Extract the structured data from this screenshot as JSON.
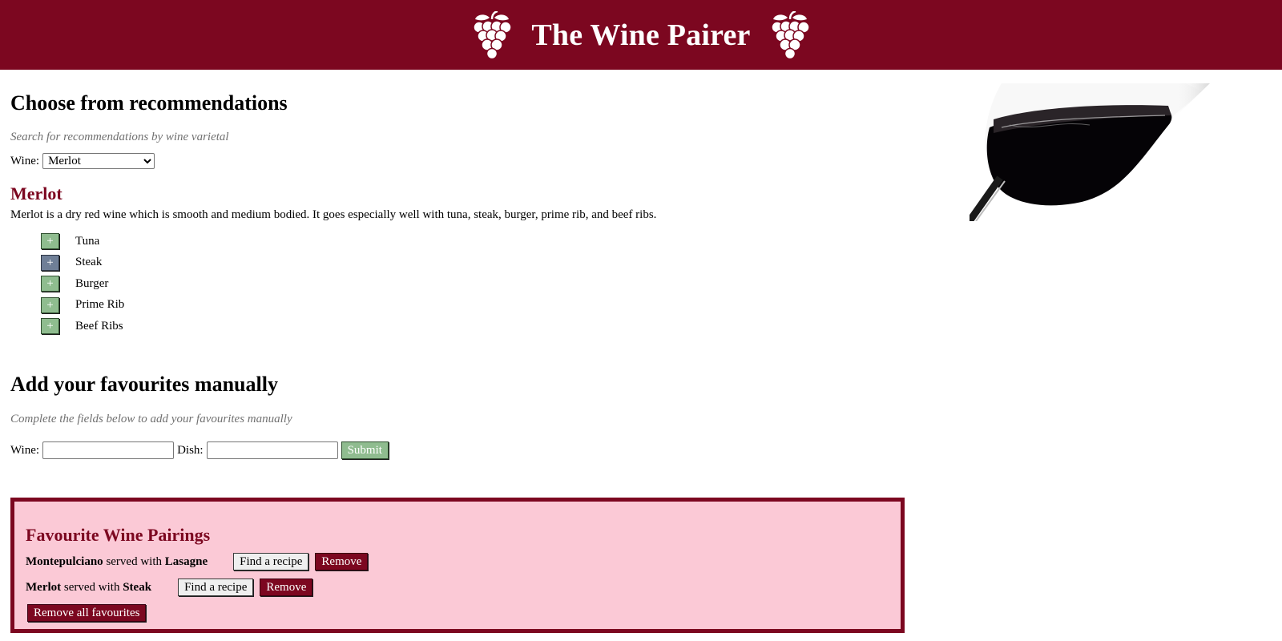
{
  "header": {
    "title": "The Wine Pairer",
    "icon": "grapes-icon",
    "background": "#7c0720"
  },
  "recommendations": {
    "heading": "Choose from recommendations",
    "hint": "Search for recommendations by wine varietal",
    "wine_label": "Wine:",
    "selected_wine": "Merlot",
    "varietal": {
      "name": "Merlot",
      "description": "Merlot is a dry red wine which is smooth and medium bodied. It goes especially well with tuna, steak, burger, prime rib, and beef ribs."
    },
    "pairings": [
      {
        "label": "Tuna",
        "button": "+",
        "active": false
      },
      {
        "label": "Steak",
        "button": "+",
        "active": true
      },
      {
        "label": "Burger",
        "button": "+",
        "active": false
      },
      {
        "label": "Prime Rib",
        "button": "+",
        "active": false
      },
      {
        "label": "Beef Ribs",
        "button": "+",
        "active": false
      }
    ]
  },
  "manual": {
    "heading": "Add your favourites manually",
    "hint": "Complete the fields below to add your favourites manually",
    "wine_label": "Wine:",
    "wine_value": "",
    "dish_label": "Dish:",
    "dish_value": "",
    "submit_label": "Submit"
  },
  "favourites": {
    "title": "Favourite Wine Pairings",
    "served_with": "served with",
    "find_recipe_label": "Find a recipe",
    "remove_label": "Remove",
    "remove_all_label": "Remove all favourites",
    "items": [
      {
        "wine": "Montepulciano",
        "dish": "Lasagne"
      },
      {
        "wine": "Merlot",
        "dish": "Steak"
      }
    ]
  },
  "colors": {
    "burgundy": "#7c0720",
    "green_button": "#8fbc8f",
    "active_button": "#6f7f97",
    "favourites_bg": "#fbc9d6"
  }
}
